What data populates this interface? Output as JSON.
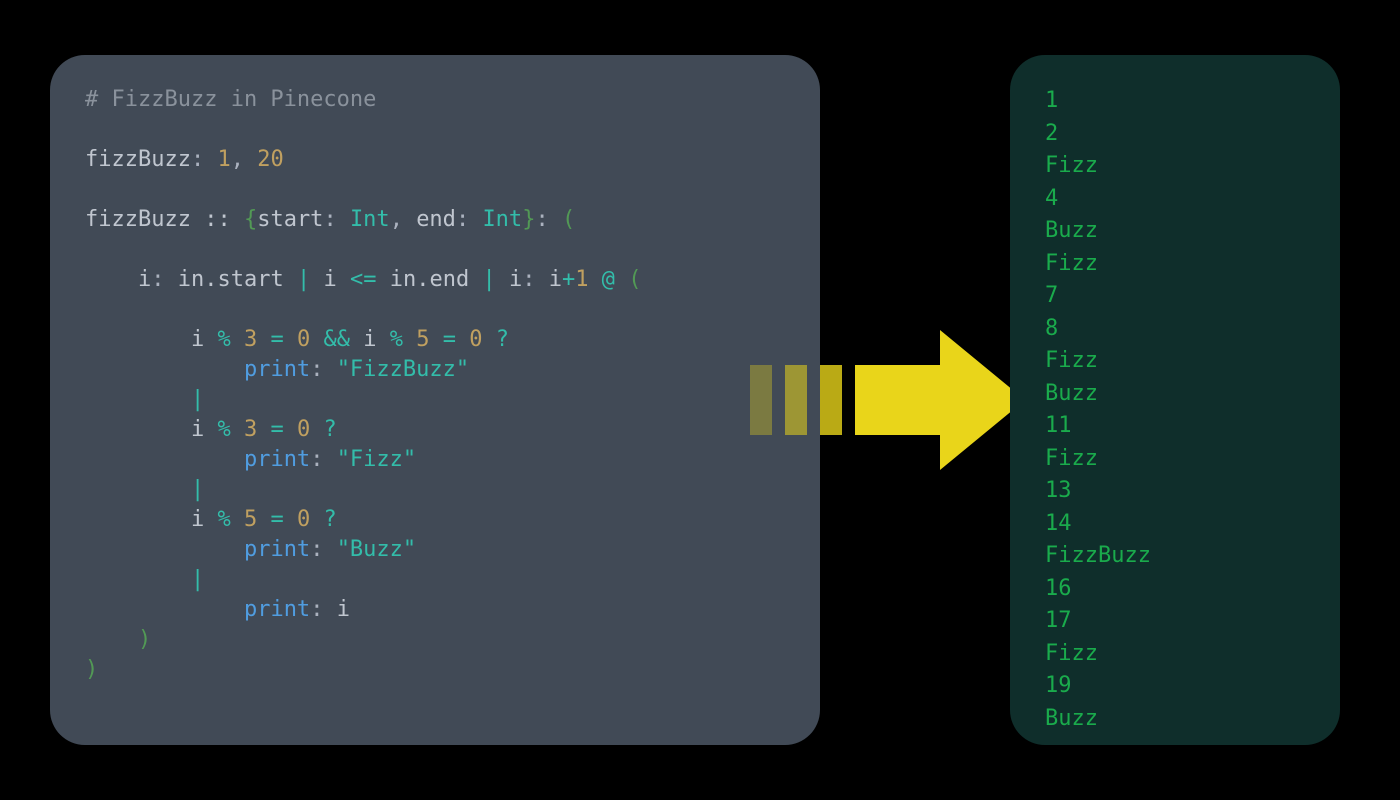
{
  "code": {
    "l1_comment": "# FizzBuzz in Pinecone",
    "l2_a": "fizzBuzz",
    "l2_colon": ": ",
    "l2_n1": "1",
    "l2_comma": ", ",
    "l2_n2": "20",
    "l3_a": "fizzBuzz :: ",
    "l3_b": "{",
    "l3_c": "start",
    "l3_d": ": ",
    "l3_e": "Int",
    "l3_f": ", ",
    "l3_g": "end",
    "l3_h": ": ",
    "l3_i": "Int",
    "l3_j": "}",
    "l3_k": ": ",
    "l3_l": "(",
    "l4_pad": "    ",
    "l4_a": "i",
    "l4_b": ": ",
    "l4_c": "in",
    "l4_d": ".start ",
    "l4_e": "| ",
    "l4_f": "i ",
    "l4_g": "<= ",
    "l4_h": "in",
    "l4_i": ".end ",
    "l4_j": "| ",
    "l4_k": "i",
    "l4_l": ": ",
    "l4_m": "i",
    "l4_n": "+",
    "l4_o": "1",
    "l4_p": " @ ",
    "l4_q": "(",
    "l5_pad": "        ",
    "l5_a": "i ",
    "l5_b": "% ",
    "l5_c": "3",
    "l5_d": " = ",
    "l5_e": "0",
    "l5_f": " && ",
    "l5_g": "i ",
    "l5_h": "% ",
    "l5_i": "5",
    "l5_j": " = ",
    "l5_k": "0",
    "l5_l": " ?",
    "l6_pad": "            ",
    "l6_a": "print",
    "l6_b": ": ",
    "l6_c": "\"FizzBuzz\"",
    "l7_pad": "        ",
    "l7_a": "|",
    "l8_pad": "        ",
    "l8_a": "i ",
    "l8_b": "% ",
    "l8_c": "3",
    "l8_d": " = ",
    "l8_e": "0",
    "l8_f": " ?",
    "l9_pad": "            ",
    "l9_a": "print",
    "l9_b": ": ",
    "l9_c": "\"Fizz\"",
    "l10_pad": "        ",
    "l10_a": "|",
    "l11_pad": "        ",
    "l11_a": "i ",
    "l11_b": "% ",
    "l11_c": "5",
    "l11_d": " = ",
    "l11_e": "0",
    "l11_f": " ?",
    "l12_pad": "            ",
    "l12_a": "print",
    "l12_b": ": ",
    "l12_c": "\"Buzz\"",
    "l13_pad": "        ",
    "l13_a": "|",
    "l14_pad": "            ",
    "l14_a": "print",
    "l14_b": ": ",
    "l14_c": "i",
    "l15_pad": "    ",
    "l15_a": ")",
    "l16_a": ")"
  },
  "output": {
    "lines": "1\n2\nFizz\n4\nBuzz\nFizz\n7\n8\nFizz\nBuzz\n11\nFizz\n13\n14\nFizzBuzz\n16\n17\nFizz\n19\nBuzz"
  },
  "colors": {
    "code_bg": "#414a56",
    "output_bg": "#0f2e2b",
    "output_text": "#1aab4c",
    "arrow": "#e9d51a"
  }
}
